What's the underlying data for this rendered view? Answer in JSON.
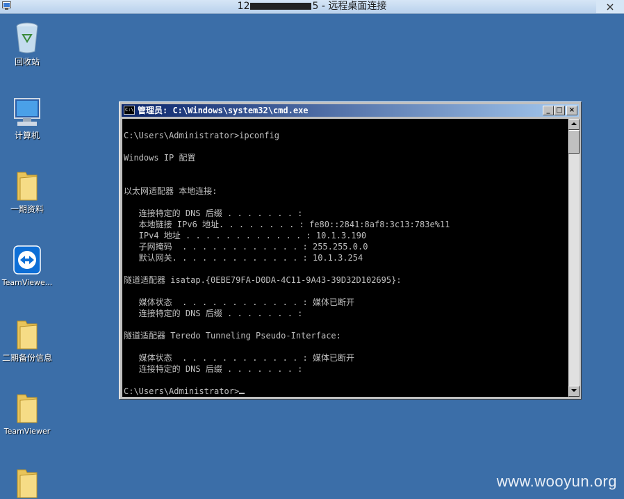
{
  "remote_desktop": {
    "title_prefix": "12",
    "title_suffix": "5 - 远程桌面连接"
  },
  "desktop_icons": [
    {
      "label": "回收站",
      "icon": "recycle-bin-icon"
    },
    {
      "label": "计算机",
      "icon": "computer-icon"
    },
    {
      "label": "一期资料",
      "icon": "folder-icon"
    },
    {
      "label": "TeamViewe...",
      "icon": "teamviewer-icon"
    },
    {
      "label": "二期备份信息",
      "icon": "folder-icon"
    },
    {
      "label": "TeamViewer",
      "icon": "folder-icon"
    },
    {
      "label": "",
      "icon": "folder-icon"
    }
  ],
  "cmd_window": {
    "title": "管理员: C:\\Windows\\system32\\cmd.exe",
    "buttons": {
      "minimize": "_",
      "maximize": "□",
      "close": "×"
    },
    "output": "C:\\Users\\Administrator>ipconfig\n\nWindows IP 配置\n\n\n以太网适配器 本地连接:\n\n   连接特定的 DNS 后缀 . . . . . . . :\n   本地链接 IPv6 地址. . . . . . . . : fe80::2841:8af8:3c13:783e%11\n   IPv4 地址 . . . . . . . . . . . . : 10.1.3.190\n   子网掩码  . . . . . . . . . . . . : 255.255.0.0\n   默认网关. . . . . . . . . . . . . : 10.1.3.254\n\n隧道适配器 isatap.{0EBE79FA-D0DA-4C11-9A43-39D32D102695}:\n\n   媒体状态  . . . . . . . . . . . . : 媒体已断开\n   连接特定的 DNS 后缀 . . . . . . . :\n\n隧道适配器 Teredo Tunneling Pseudo-Interface:\n\n   媒体状态  . . . . . . . . . . . . : 媒体已断开\n   连接特定的 DNS 后缀 . . . . . . . :\n\n",
    "prompt": "C:\\Users\\Administrator>"
  },
  "watermark": "www.wooyun.org",
  "colors": {
    "desktop": "#3b6ea8",
    "cmd_background": "#000000",
    "cmd_text": "#c0c0c0",
    "title_gradient_start": "#0a246a",
    "title_gradient_end": "#a6caf0"
  }
}
